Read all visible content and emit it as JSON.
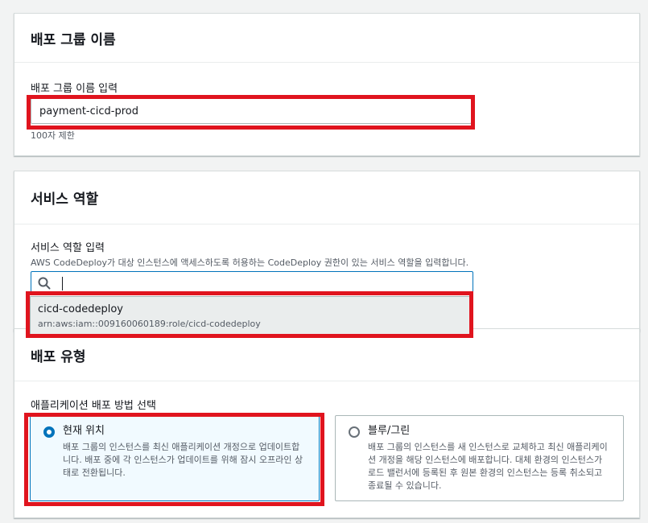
{
  "deployment_group": {
    "header": "배포 그룹 이름",
    "field_label": "배포 그룹 이름 입력",
    "input_value": "payment-cicd-prod",
    "constraint": "100자 제한"
  },
  "service_role": {
    "header": "서비스 역할",
    "field_label": "서비스 역할 입력",
    "description": "AWS CodeDeploy가 대상 인스턴스에 액세스하도록 허용하는 CodeDeploy 권한이 있는 서비스 역할을 입력합니다.",
    "search_value": "",
    "dropdown_option": {
      "name": "cicd-codedeploy",
      "arn": "arn:aws:iam::009160060189:role/cicd-codedeploy"
    }
  },
  "deployment_type": {
    "header": "배포 유형",
    "field_label": "애플리케이션 배포 방법 선택",
    "options": [
      {
        "title": "현재 위치",
        "description": "배포 그룹의 인스턴스를 최신 애플리케이션 개정으로 업데이트합니다. 배포 중에 각 인스턴스가 업데이트를 위해 잠시 오프라인 상태로 전환됩니다.",
        "selected": true
      },
      {
        "title": "블루/그린",
        "description": "배포 그룹의 인스턴스를 새 인스턴스로 교체하고 최신 애플리케이션 개정을 해당 인스턴스에 배포합니다. 대체 환경의 인스턴스가 로드 밸런서에 등록된 후 원본 환경의 인스턴스는 등록 취소되고 종료될 수 있습니다.",
        "selected": false
      }
    ]
  },
  "colors": {
    "highlight": "#e0141e",
    "accent": "#0073bb",
    "selected_bg": "#f1faff"
  }
}
